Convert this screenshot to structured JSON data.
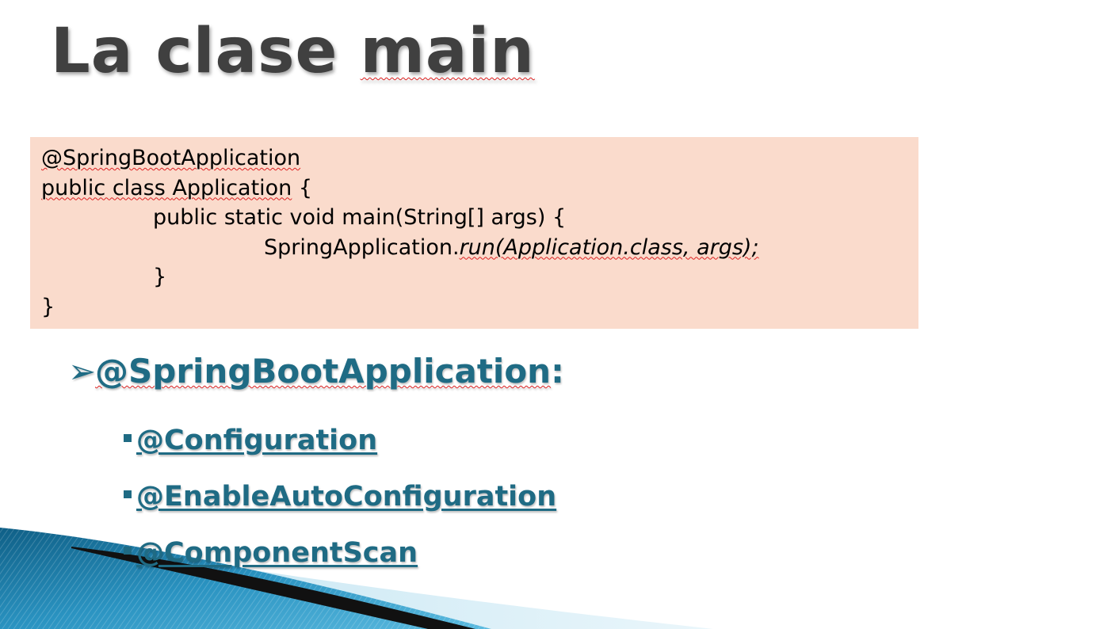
{
  "slide": {
    "title_part1": "La clase ",
    "title_part2": "main"
  },
  "code": {
    "line1": "@SpringBootApplication",
    "line2_kw": "public class ",
    "line2_name": "Application",
    "line2_end": " {",
    "line3": "public static void main(String[] args) {",
    "line4_plain": "SpringApplication.",
    "line4_italic": "run(Application.class, args);",
    "line5": "}",
    "line6": "}"
  },
  "bullets": {
    "main_label": "@SpringBootApplication",
    "main_colon": ":",
    "sub": [
      "@Configuration",
      "@EnableAutoConfiguration",
      "@ComponentScan"
    ]
  },
  "colors": {
    "title": "#404040",
    "code_background": "#fadbcc",
    "bullet_text": "#1f6b84",
    "decoration_blue": "#1d7aa3"
  }
}
